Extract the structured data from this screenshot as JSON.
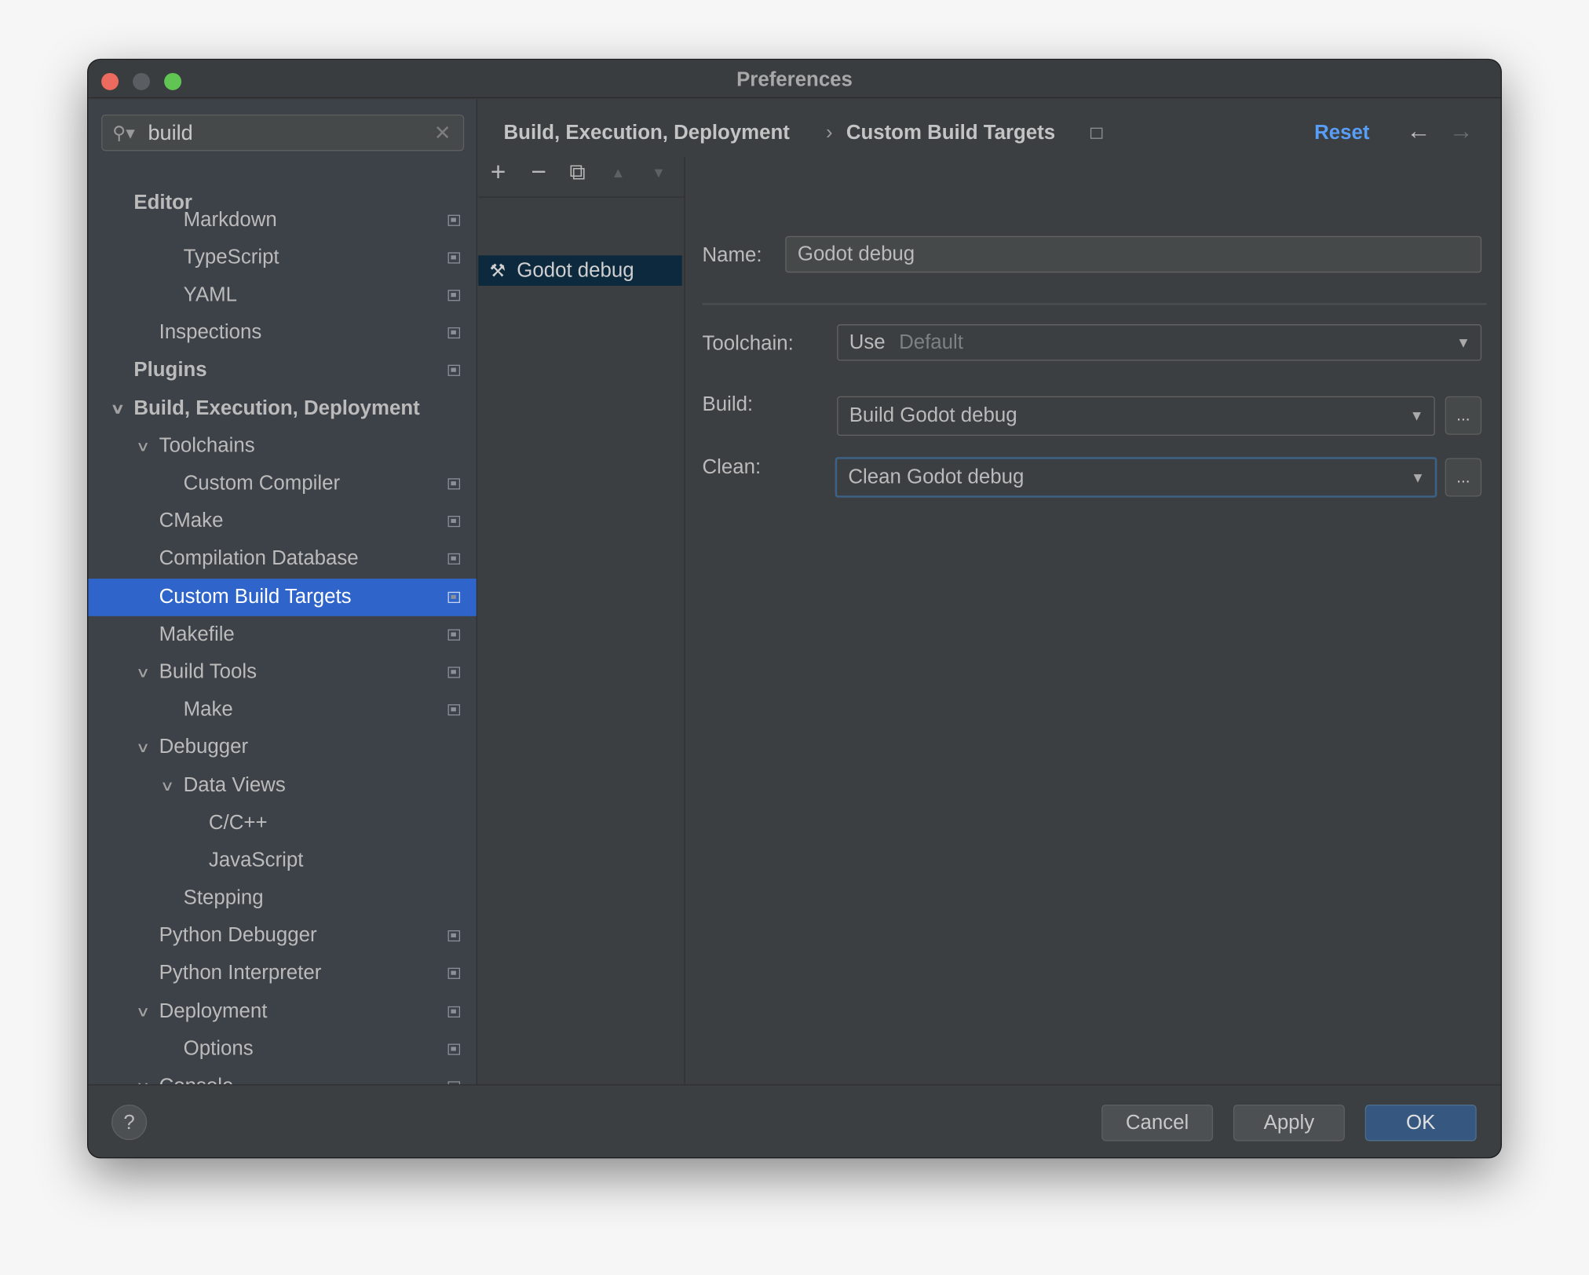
{
  "window": {
    "title": "Preferences"
  },
  "search": {
    "value": "build",
    "icon": "search-icon"
  },
  "tree": [
    {
      "label": "Editor",
      "level": 0,
      "bold": true,
      "chevron": false,
      "icon": false
    },
    {
      "label": "Markdown",
      "level": 2,
      "bold": false,
      "chevron": false,
      "icon": true
    },
    {
      "label": "TypeScript",
      "level": 2,
      "bold": false,
      "chevron": false,
      "icon": true
    },
    {
      "label": "YAML",
      "level": 2,
      "bold": false,
      "chevron": false,
      "icon": true
    },
    {
      "label": "Inspections",
      "level": 1,
      "bold": false,
      "chevron": false,
      "icon": true
    },
    {
      "label": "Plugins",
      "level": 0,
      "bold": true,
      "chevron": false,
      "icon": true
    },
    {
      "label": "Build, Execution, Deployment",
      "level": 0,
      "bold": true,
      "chevron": true,
      "icon": false
    },
    {
      "label": "Toolchains",
      "level": 1,
      "bold": false,
      "chevron": true,
      "icon": false
    },
    {
      "label": "Custom Compiler",
      "level": 2,
      "bold": false,
      "chevron": false,
      "icon": true
    },
    {
      "label": "CMake",
      "level": 1,
      "bold": false,
      "chevron": false,
      "icon": true
    },
    {
      "label": "Compilation Database",
      "level": 1,
      "bold": false,
      "chevron": false,
      "icon": true
    },
    {
      "label": "Custom Build Targets",
      "level": 1,
      "bold": false,
      "chevron": false,
      "icon": true,
      "selected": true
    },
    {
      "label": "Makefile",
      "level": 1,
      "bold": false,
      "chevron": false,
      "icon": true
    },
    {
      "label": "Build Tools",
      "level": 1,
      "bold": false,
      "chevron": true,
      "icon": true
    },
    {
      "label": "Make",
      "level": 2,
      "bold": false,
      "chevron": false,
      "icon": true
    },
    {
      "label": "Debugger",
      "level": 1,
      "bold": false,
      "chevron": true,
      "icon": false
    },
    {
      "label": "Data Views",
      "level": 2,
      "bold": false,
      "chevron": true,
      "icon": false
    },
    {
      "label": "C/C++",
      "level": 3,
      "bold": false,
      "chevron": false,
      "icon": false
    },
    {
      "label": "JavaScript",
      "level": 3,
      "bold": false,
      "chevron": false,
      "icon": false
    },
    {
      "label": "Stepping",
      "level": 2,
      "bold": false,
      "chevron": false,
      "icon": false
    },
    {
      "label": "Python Debugger",
      "level": 1,
      "bold": false,
      "chevron": false,
      "icon": true
    },
    {
      "label": "Python Interpreter",
      "level": 1,
      "bold": false,
      "chevron": false,
      "icon": true
    },
    {
      "label": "Deployment",
      "level": 1,
      "bold": false,
      "chevron": true,
      "icon": true
    },
    {
      "label": "Options",
      "level": 2,
      "bold": false,
      "chevron": false,
      "icon": true
    },
    {
      "label": "Console",
      "level": 1,
      "bold": false,
      "chevron": true,
      "icon": true
    }
  ],
  "header": {
    "crumb1": "Build, Execution, Deployment",
    "separator": "›",
    "crumb2": "Custom Build Targets",
    "reset": "Reset",
    "back": "←",
    "forward": "→",
    "accent": "#589df6"
  },
  "toolbar": {
    "add": "+",
    "remove": "−",
    "copy": "⧉",
    "up": "▲",
    "down": "▼"
  },
  "targets": [
    {
      "label": "Godot debug",
      "icon": "hammer-wrench-icon"
    }
  ],
  "form": {
    "name_label": "Name:",
    "name_value": "Godot debug",
    "toolchain_label": "Toolchain:",
    "toolchain_prefix": "Use",
    "toolchain_value": "Default",
    "build_label": "Build:",
    "build_value": "Build Godot debug",
    "clean_label": "Clean:",
    "clean_value": "Clean Godot debug",
    "ellipsis": "..."
  },
  "footer": {
    "help": "?",
    "cancel": "Cancel",
    "apply": "Apply",
    "ok": "OK"
  }
}
